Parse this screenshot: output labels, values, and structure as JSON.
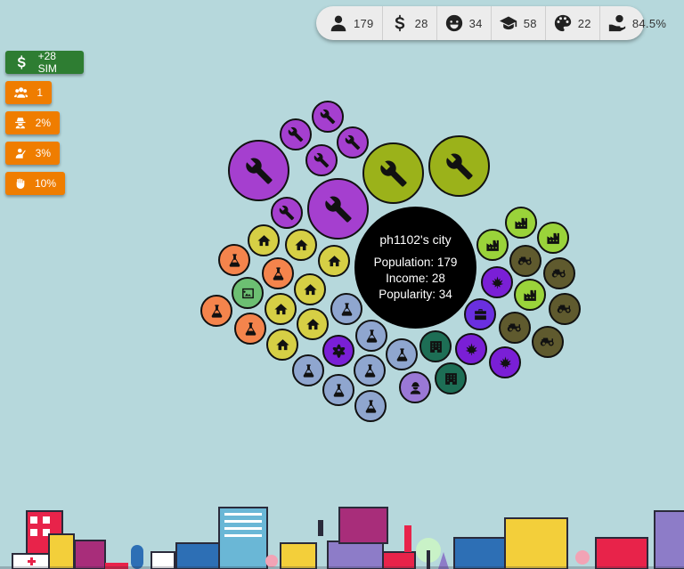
{
  "stats": [
    {
      "icon": "person-icon",
      "value": "179"
    },
    {
      "icon": "dollar-icon",
      "value": "28"
    },
    {
      "icon": "smile-icon",
      "value": "34"
    },
    {
      "icon": "graduation-cap-icon",
      "value": "58"
    },
    {
      "icon": "palette-icon",
      "value": "22"
    },
    {
      "icon": "hand-coin-icon",
      "value": "84.5%"
    }
  ],
  "side_buttons": {
    "sim_label": "+28 SIM",
    "users_label": "1",
    "spy_label": "2%",
    "teacher_label": "3%",
    "fist_label": "10%"
  },
  "city": {
    "name": "ph1102's city",
    "population": "Population: 179",
    "income": "Income: 28",
    "popularity": "Popularity: 34"
  },
  "colors": {
    "background": "#b6d8dc",
    "purple": "#a53fcf",
    "olive": "#9bb21a",
    "yellow": "#d6cf45",
    "orange": "#f4844c",
    "steel": "#8fa6cf",
    "dark_teal": "#1d6e55",
    "violet": "#7a1fd6",
    "lime": "#9ad33a",
    "brown": "#5f5a2e",
    "green": "#6cbf72",
    "lavender": "#9a78d6",
    "indigo": "#6a2fe0"
  }
}
